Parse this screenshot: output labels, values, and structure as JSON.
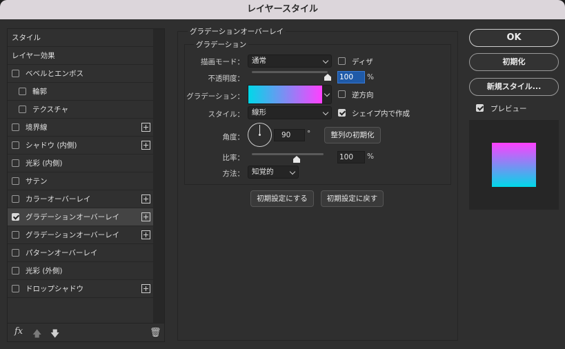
{
  "window": {
    "title": "レイヤースタイル"
  },
  "sidebar": {
    "items": [
      {
        "label": "スタイル",
        "checkbox": false,
        "checked": false,
        "plus": false,
        "selected": false
      },
      {
        "label": "レイヤー効果",
        "checkbox": false,
        "checked": false,
        "plus": false,
        "selected": false
      },
      {
        "label": "ベベルとエンボス",
        "checkbox": true,
        "checked": false,
        "plus": false,
        "selected": false
      },
      {
        "label": "輪郭",
        "checkbox": true,
        "checked": false,
        "plus": false,
        "selected": false,
        "indent": true
      },
      {
        "label": "テクスチャ",
        "checkbox": true,
        "checked": false,
        "plus": false,
        "selected": false,
        "indent": true
      },
      {
        "label": "境界線",
        "checkbox": true,
        "checked": false,
        "plus": true,
        "selected": false
      },
      {
        "label": "シャドウ (内側)",
        "checkbox": true,
        "checked": false,
        "plus": true,
        "selected": false
      },
      {
        "label": "光彩 (内側)",
        "checkbox": true,
        "checked": false,
        "plus": false,
        "selected": false
      },
      {
        "label": "サテン",
        "checkbox": true,
        "checked": false,
        "plus": false,
        "selected": false
      },
      {
        "label": "カラーオーバーレイ",
        "checkbox": true,
        "checked": false,
        "plus": true,
        "selected": false
      },
      {
        "label": "グラデーションオーバーレイ",
        "checkbox": true,
        "checked": true,
        "plus": true,
        "selected": true
      },
      {
        "label": "グラデーションオーバーレイ",
        "checkbox": true,
        "checked": false,
        "plus": true,
        "selected": false
      },
      {
        "label": "パターンオーバーレイ",
        "checkbox": true,
        "checked": false,
        "plus": false,
        "selected": false
      },
      {
        "label": "光彩 (外側)",
        "checkbox": true,
        "checked": false,
        "plus": false,
        "selected": false
      },
      {
        "label": "ドロップシャドウ",
        "checkbox": true,
        "checked": false,
        "plus": true,
        "selected": false
      }
    ],
    "bottom": {
      "fx_label": "fx",
      "up_icon": "arrow-up-icon",
      "down_icon": "arrow-down-icon",
      "trash_icon": "trash-icon"
    }
  },
  "panel": {
    "section_title": "グラデーションオーバーレイ",
    "subsection_title": "グラデーション",
    "blend_mode": {
      "label": "描画モード：",
      "value": "通常"
    },
    "dither": {
      "label": "ディザ",
      "checked": false
    },
    "opacity": {
      "label": "不透明度：",
      "value": "100",
      "unit": "%",
      "fraction": 1.0
    },
    "gradient": {
      "label": "グラデーション：",
      "colors": [
        "#00d8e8",
        "#ff40ff"
      ]
    },
    "reverse": {
      "label": "逆方向",
      "checked": false
    },
    "style": {
      "label": "スタイル：",
      "value": "線形"
    },
    "align_with_layer": {
      "label": "シェイプ内で作成",
      "checked": true
    },
    "angle": {
      "label": "角度：",
      "value": "90",
      "unit": "°"
    },
    "reset_alignment_label": "整列の初期化",
    "scale": {
      "label": "比率：",
      "value": "100",
      "unit": "%",
      "fraction": 0.5
    },
    "method": {
      "label": "方法：",
      "value": "知覚的"
    },
    "make_default_label": "初期設定にする",
    "reset_default_label": "初期設定に戻す"
  },
  "actions": {
    "ok_label": "OK",
    "reset_label": "初期化",
    "new_style_label": "新規スタイル...",
    "preview": {
      "label": "プレビュー",
      "checked": true
    },
    "preview_colors": [
      "#ff40ff",
      "#00d8e8"
    ]
  }
}
